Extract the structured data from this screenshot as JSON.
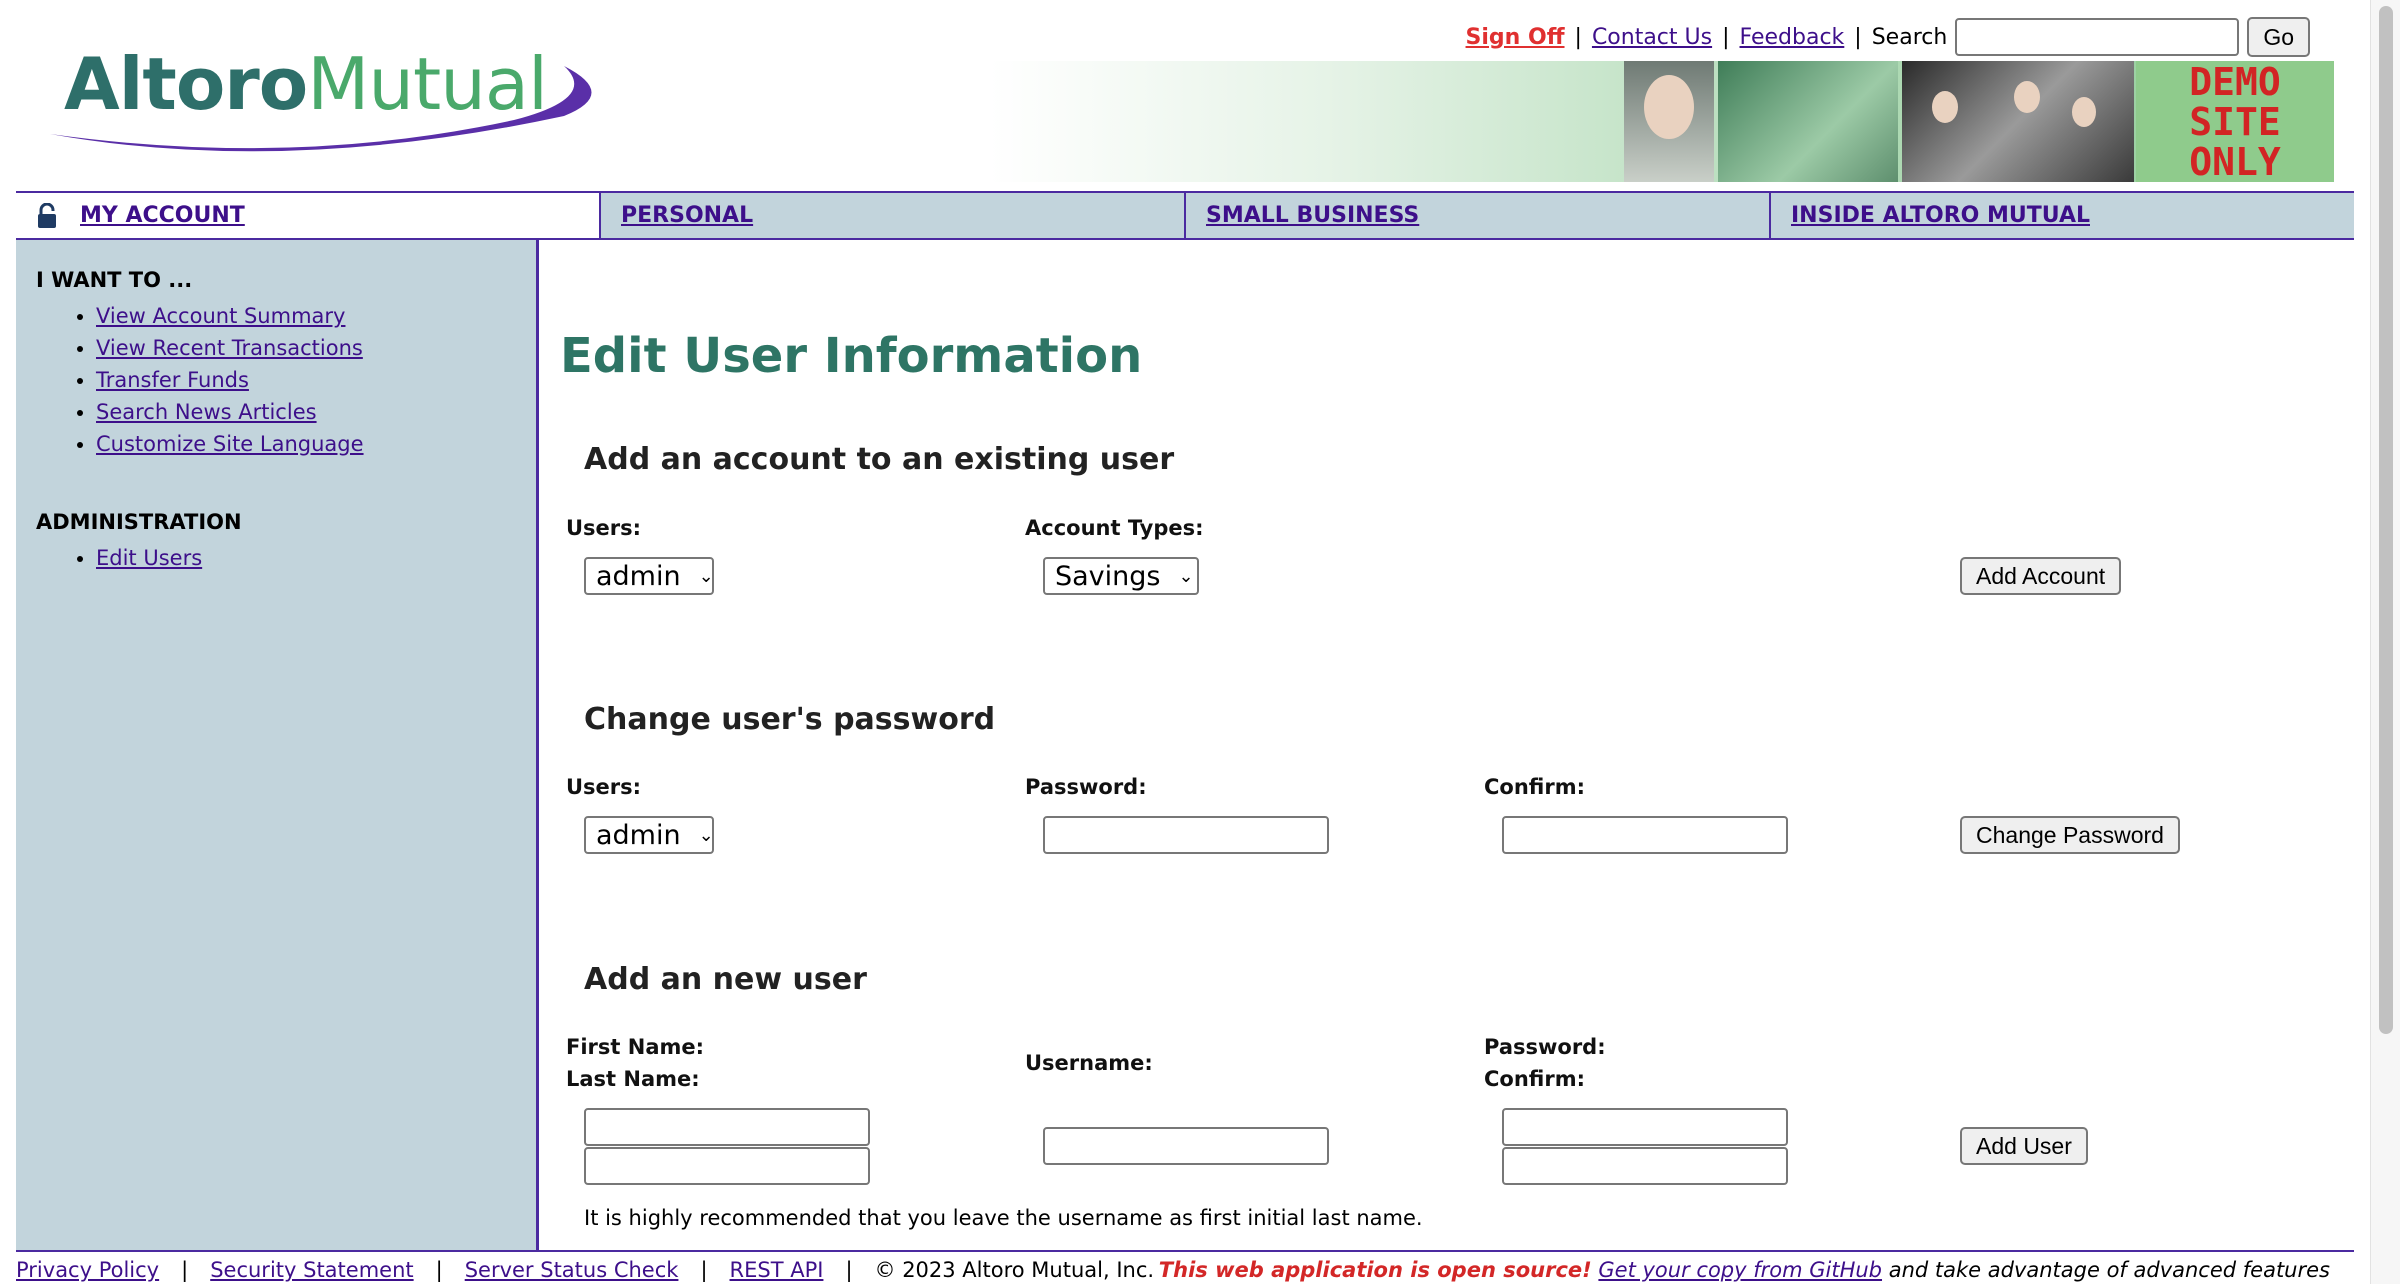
{
  "header": {
    "logo_part1": "Altoro",
    "logo_part2": "Mutual",
    "sign_off": "Sign Off",
    "contact_us": "Contact Us",
    "feedback": "Feedback",
    "sep": "|",
    "search_label": "Search",
    "search_value": "",
    "go_label": "Go",
    "demo_text": "DEMO SITE ONLY"
  },
  "nav": {
    "items": [
      {
        "label": "MY ACCOUNT",
        "icon": "lock-icon"
      },
      {
        "label": "PERSONAL"
      },
      {
        "label": "SMALL BUSINESS"
      },
      {
        "label": "INSIDE ALTORO MUTUAL"
      }
    ]
  },
  "sidebar": {
    "heading1": "I WANT TO ...",
    "links1": [
      "View Account Summary",
      "View Recent Transactions",
      "Transfer Funds",
      "Search News Articles",
      "Customize Site Language"
    ],
    "heading2": "ADMINISTRATION",
    "links2": [
      "Edit Users"
    ]
  },
  "main": {
    "title": "Edit User Information",
    "add_account": {
      "title": "Add an account to an existing user",
      "users_label": "Users:",
      "users_value": "admin",
      "types_label": "Account Types:",
      "types_value": "Savings",
      "button": "Add Account"
    },
    "change_password": {
      "title": "Change user's password",
      "users_label": "Users:",
      "users_value": "admin",
      "password_label": "Password:",
      "confirm_label": "Confirm:",
      "button": "Change Password"
    },
    "new_user": {
      "title": "Add an new user",
      "first_name_label": "First Name:",
      "last_name_label": "Last Name:",
      "username_label": "Username:",
      "password_label": "Password:",
      "confirm_label": "Confirm:",
      "button": "Add User",
      "note": "It is highly recommended that you leave the username as first initial last name."
    }
  },
  "footer": {
    "links": [
      "Privacy Policy",
      "Security Statement",
      "Server Status Check",
      "REST API"
    ],
    "sep": "|",
    "copyright": "© 2023 Altoro Mutual, Inc.",
    "promo_red": "This web application is open source!",
    "promo_link": "Get your copy from GitHub",
    "promo_rest": "and take advantage of advanced features"
  },
  "colors": {
    "accent_purple": "#4b2aa0",
    "nav_bg": "#c2d4dc",
    "title_green": "#2e7565",
    "link": "#3d0f8a",
    "sign_off_red": "#e03030"
  }
}
